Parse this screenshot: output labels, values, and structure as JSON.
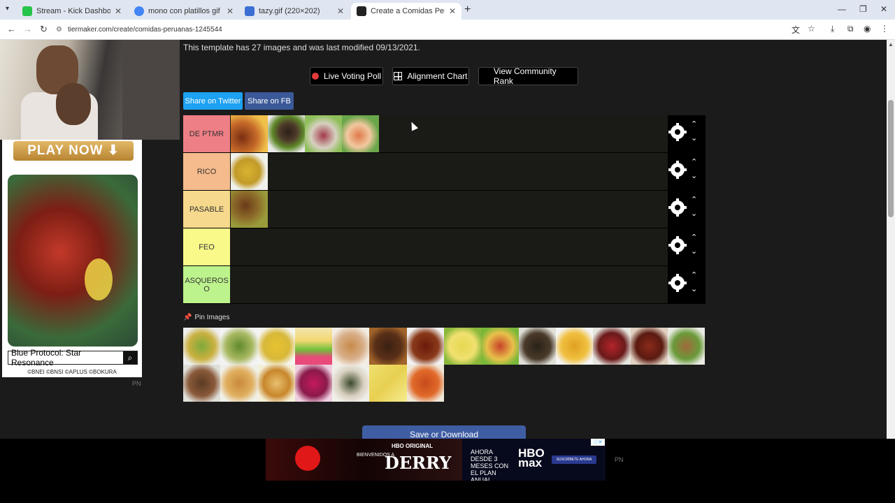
{
  "browser": {
    "tabs": [
      {
        "title": "Stream - Kick Dashboard",
        "favicon_color": "#27c44c"
      },
      {
        "title": "mono con platillos gif - Buscar",
        "favicon_color": "#4285f4"
      },
      {
        "title": "tazy.gif (220×202)",
        "favicon_color": "#3b6fd4"
      },
      {
        "title": "Create a Comidas Peruanas Tie",
        "favicon_color": "#222222"
      }
    ],
    "url": "tiermaker.com/create/comidas-peruanas-1245544"
  },
  "page": {
    "modified_text": "This template has 27 images and was last modified 09/13/2021.",
    "buttons": {
      "live_voting": "Live Voting Poll",
      "alignment": "Alignment Chart",
      "community": "View Community Rank",
      "share_twitter": "Share on Twitter",
      "share_fb": "Share on FB"
    },
    "tiers": [
      {
        "label": "DE PTMR",
        "color": "#ef7f86",
        "items": [
          "chicken-fries",
          "green-noodles-steak",
          "ceviche",
          "fish-salad",
          "stuffed-potato"
        ]
      },
      {
        "label": "RICO",
        "color": "#f6bb8c",
        "items": [
          "aji-de-gallina"
        ]
      },
      {
        "label": "PASABLE",
        "color": "#f6d98c",
        "items": [
          "seco-con-pollo"
        ]
      },
      {
        "label": "FEO",
        "color": "#f9f98a",
        "items": []
      },
      {
        "label": "ASQUEROS O",
        "color": "#bdf38c",
        "items": []
      }
    ],
    "pin_label": "Pin Images",
    "pool_count": 21,
    "save_label": "Save or Download"
  },
  "ads": {
    "left": {
      "cta": "PLAY NOW ⬇",
      "game": "Blue Protocol: Star Resonance",
      "copyright": "©BNEI ©BNSI ©APLUS ©BOKURA",
      "pn": "PN"
    },
    "bottom": {
      "brand": "HBO ORIGINAL",
      "subtitle": "BIENVENIDOS A",
      "title": "DERRY",
      "offer": "AHORA DESDE 3 MESES CON EL PLAN ANUAL",
      "logo": "HBO max",
      "cta": "SUSCRÍBETE AHORA",
      "pn": "PN"
    }
  },
  "colors": {
    "page_bg": "#1b1b1b",
    "twitter": "#1da1f2",
    "facebook": "#3b5998",
    "save": "#3f5da3"
  }
}
